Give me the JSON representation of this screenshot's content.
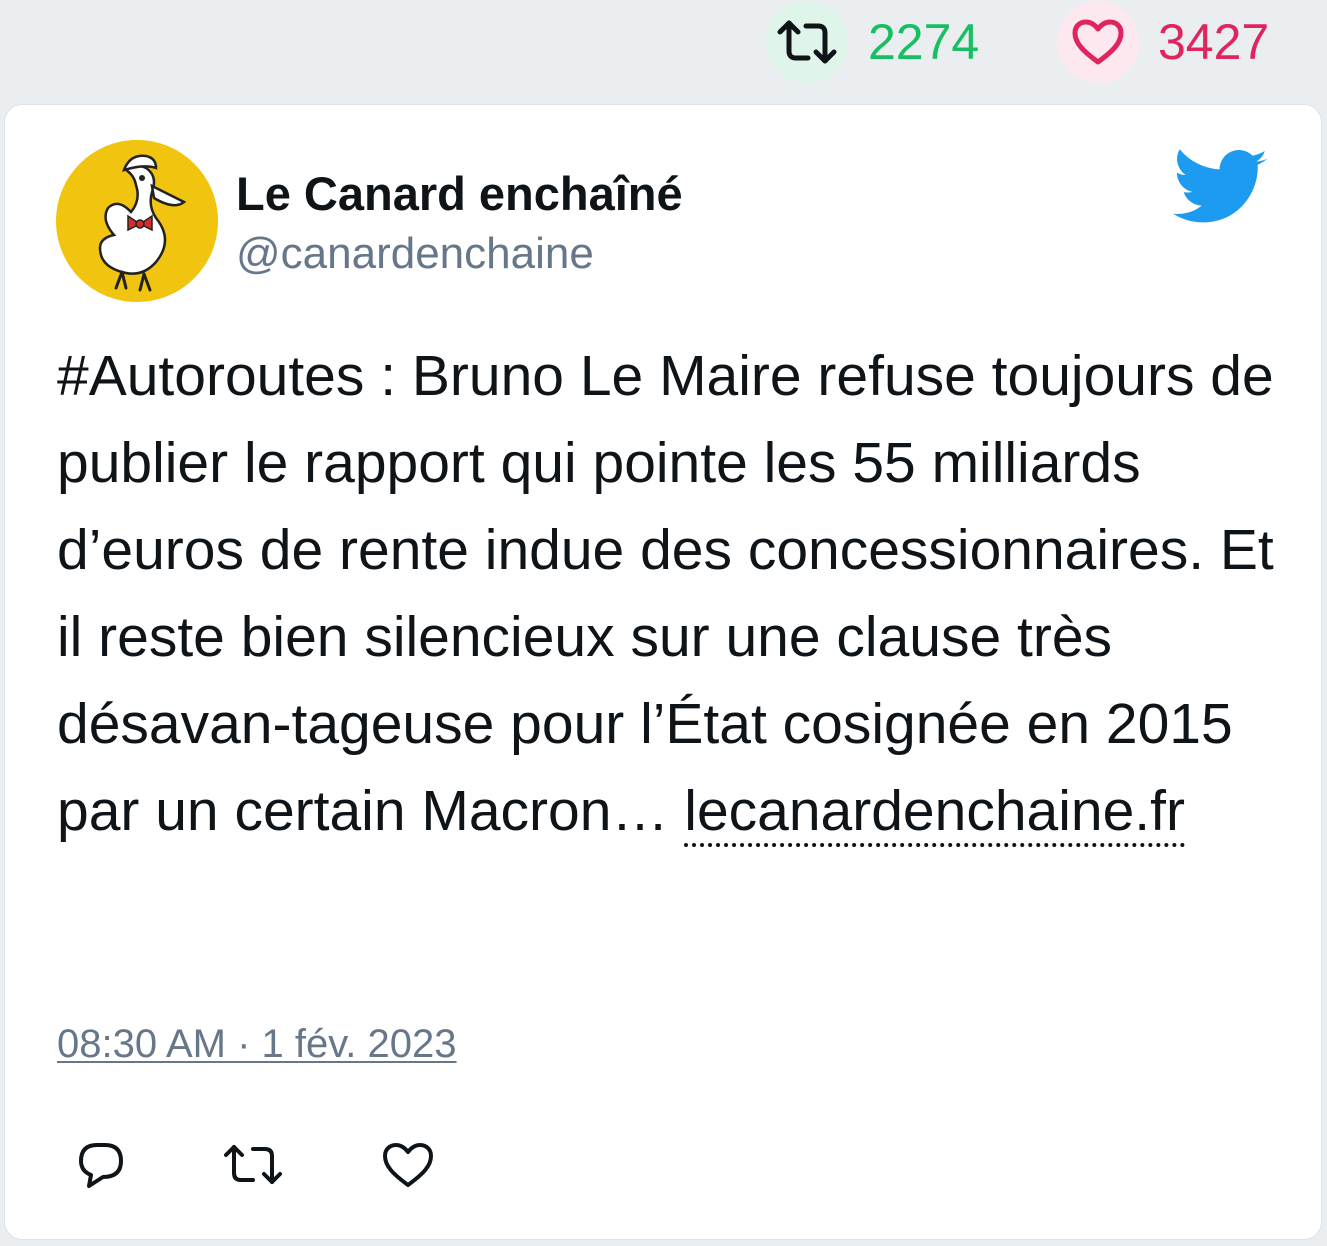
{
  "stats": {
    "retweets": "2274",
    "likes": "3427",
    "retweet_color": "#17bf63",
    "retweet_bg": "#e0f5ea",
    "like_color": "#e0245e",
    "like_bg": "#fde8ef"
  },
  "author": {
    "name": "Le Canard enchaîné",
    "handle": "@canardenchaine",
    "avatar_icon": "duck-logo",
    "avatar_bg": "#f1c40f"
  },
  "platform_icon": "twitter-bird-icon",
  "platform_color": "#1d9bf0",
  "tweet": {
    "text": "#Autoroutes : Bruno Le Maire refuse toujours de publier le rapport qui pointe les 55 milliards d’euros de rente indue des concessionnaires. Et il reste bien silencieux sur une clause très désavan-tageuse pour l’État cosignée en 2015 par un certain Macron… ",
    "link": "lecanardenchaine.fr",
    "timestamp": "08:30 AM · 1 fév. 2023"
  },
  "actions": [
    {
      "name": "reply",
      "icon": "reply-icon"
    },
    {
      "name": "retweet",
      "icon": "retweet-icon"
    },
    {
      "name": "like",
      "icon": "heart-icon"
    }
  ]
}
